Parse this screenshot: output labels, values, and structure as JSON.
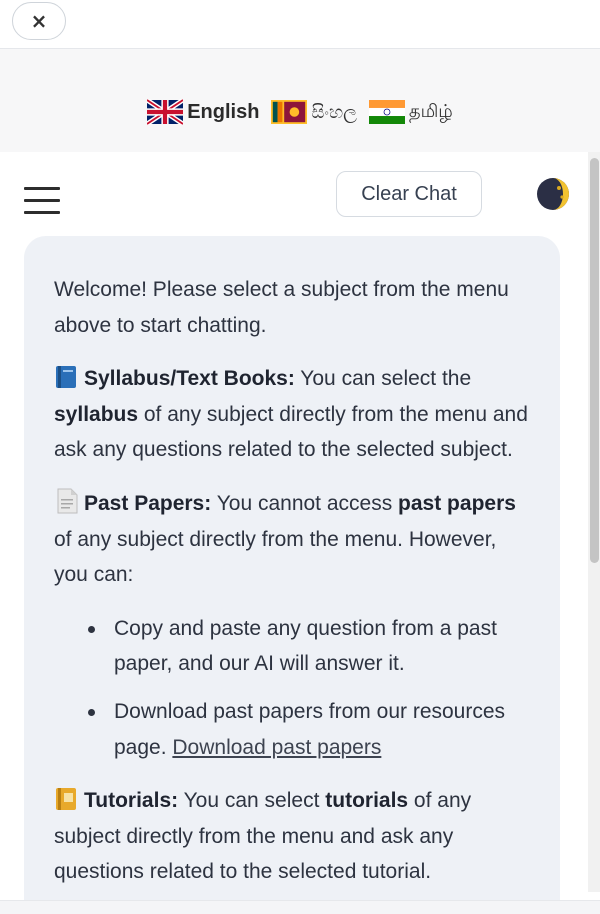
{
  "header": {
    "close_label": "×"
  },
  "languages": [
    {
      "label": "English",
      "flag": "uk-flag-icon"
    },
    {
      "label": "සිංහල",
      "flag": "sri-lanka-flag-icon"
    },
    {
      "label": "தமிழ்",
      "flag": "india-flag-icon"
    }
  ],
  "toolbar": {
    "clear_label": "Clear Chat",
    "menu_icon": "hamburger-menu-icon",
    "theme_icon": "moon-icon"
  },
  "welcome": {
    "intro": "Welcome! Please select a subject from the menu above to start chatting.",
    "syllabus": {
      "heading": "Syllabus/Text Books:",
      "text_a": " You can select the ",
      "bold": "syllabus",
      "text_b": " of any subject directly from the menu and ask any questions related to the selected subject."
    },
    "papers": {
      "heading": "Past Papers:",
      "text_a": " You cannot access ",
      "bold": "past papers",
      "text_b": " of any subject directly from the menu. However, you can:",
      "bullet_1": "Copy and paste any question from a past paper, and our AI will answer it.",
      "bullet_2": "Download past papers from our resources page. ",
      "link": "Download past papers"
    },
    "tutorials": {
      "heading": "Tutorials:",
      "text_a": " You can select ",
      "bold": "tutorials",
      "text_b": " of any subject directly from the menu and ask any questions related to the selected tutorial."
    }
  },
  "colors": {
    "card_bg": "#eef1f6",
    "text": "#2d3340"
  }
}
